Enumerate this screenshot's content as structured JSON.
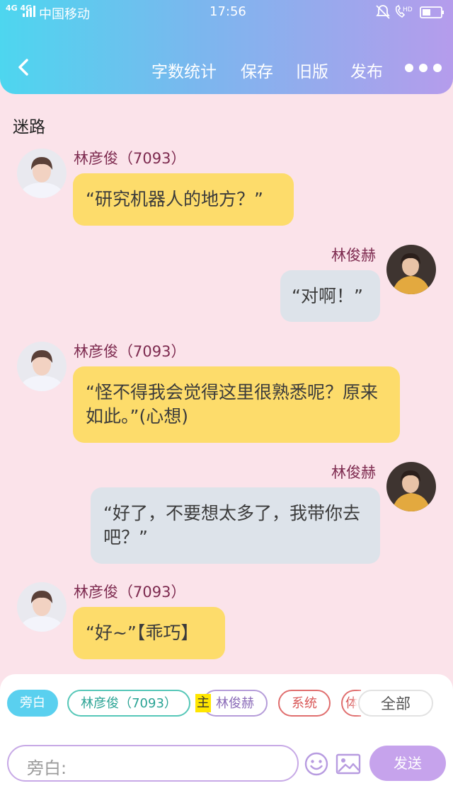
{
  "status_bar": {
    "network": "4G 4G",
    "carrier": "中国移动",
    "time": "17:56",
    "hd": "HD"
  },
  "header": {
    "back_icon": "chevron-left-icon",
    "actions": [
      "字数统计",
      "保存",
      "旧版",
      "发布"
    ],
    "more_icon": "more-dots-icon"
  },
  "chapter_title": "迷路",
  "messages": [
    {
      "speaker": "林彦俊（7093）",
      "side": "left",
      "text": "“研究机器人的地方？”"
    },
    {
      "speaker": "林俊赫",
      "side": "right",
      "text": "“对啊！”"
    },
    {
      "speaker": "林彦俊（7093）",
      "side": "left",
      "text": "“怪不得我会觉得这里很熟悉呢？原来如此。”(心想)"
    },
    {
      "speaker": "林俊赫",
      "side": "right",
      "text": "“好了，不要想太多了，我带你去吧？”"
    },
    {
      "speaker": "林彦俊（7093）",
      "side": "left",
      "text": "“好~”【乖巧】"
    }
  ],
  "role_chips": {
    "aside": "旁白",
    "lin_yanjun": "林彦俊（7093）",
    "main_badge": "主",
    "lin_junhe": "林俊赫",
    "system": "系统",
    "cut": "体",
    "all": "全部"
  },
  "composer": {
    "placeholder": "旁白:",
    "emoji_icon": "smiley-icon",
    "image_icon": "image-icon",
    "send_label": "发送"
  },
  "colors": {
    "header_gradient": [
      "#4dd6ef",
      "#b59cec"
    ],
    "page_bg": "#fbe3ea",
    "bubble_left": "#fddc6b",
    "bubble_right": "#dde3ea",
    "speaker_name": "#7d2a4f",
    "send_button": "#c6a3ec"
  }
}
